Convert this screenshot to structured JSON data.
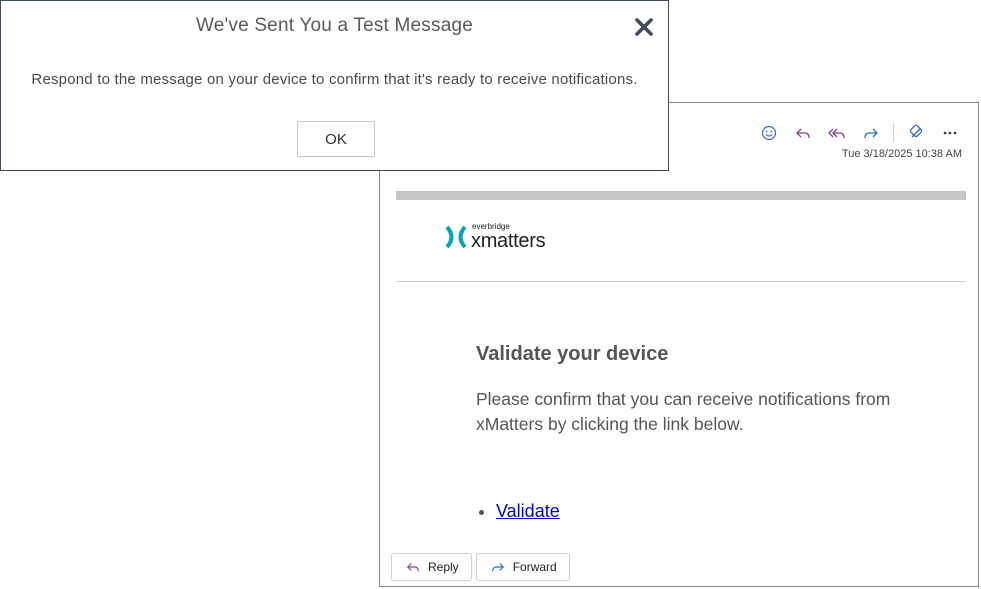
{
  "dialog": {
    "title": "We've Sent You a Test Message",
    "message": "Respond to the message on your device to confirm that it's ready to receive notifications.",
    "ok_label": "OK"
  },
  "email": {
    "timestamp": "Tue 3/18/2025 10:38 AM",
    "toolbar_icons": [
      "emoji-icon",
      "reply-icon",
      "reply-all-icon",
      "forward-icon",
      "loop-icon",
      "more-icon"
    ],
    "logo": {
      "small": "everbridge",
      "big": "xmatters",
      "color": "#0aa3b5"
    },
    "heading": "Validate your device",
    "body": "Please confirm that you can receive notifications from xMatters by clicking the link below.",
    "link_label": "Validate",
    "reply_label": "Reply",
    "forward_label": "Forward"
  }
}
